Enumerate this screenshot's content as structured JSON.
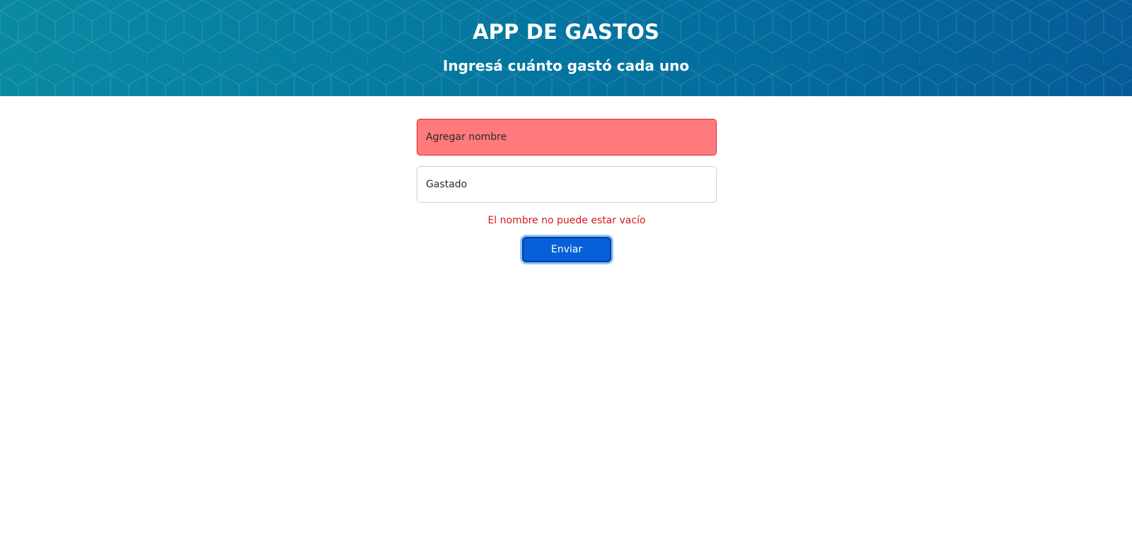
{
  "header": {
    "title": "APP DE GASTOS",
    "subtitle": "Ingresá cuánto gastó cada uno"
  },
  "form": {
    "name_input": {
      "placeholder": "Agregar nombre",
      "value": ""
    },
    "spent_input": {
      "placeholder": "Gastado",
      "value": ""
    },
    "error_message": "El nombre no puede estar vacío",
    "submit_label": "Enviar"
  },
  "colors": {
    "header_gradient_start": "#0a8aa2",
    "header_gradient_end": "#055c98",
    "error_field_background": "#ff7a7b",
    "error_text": "#d5191e",
    "button_background": "#075fd9"
  }
}
